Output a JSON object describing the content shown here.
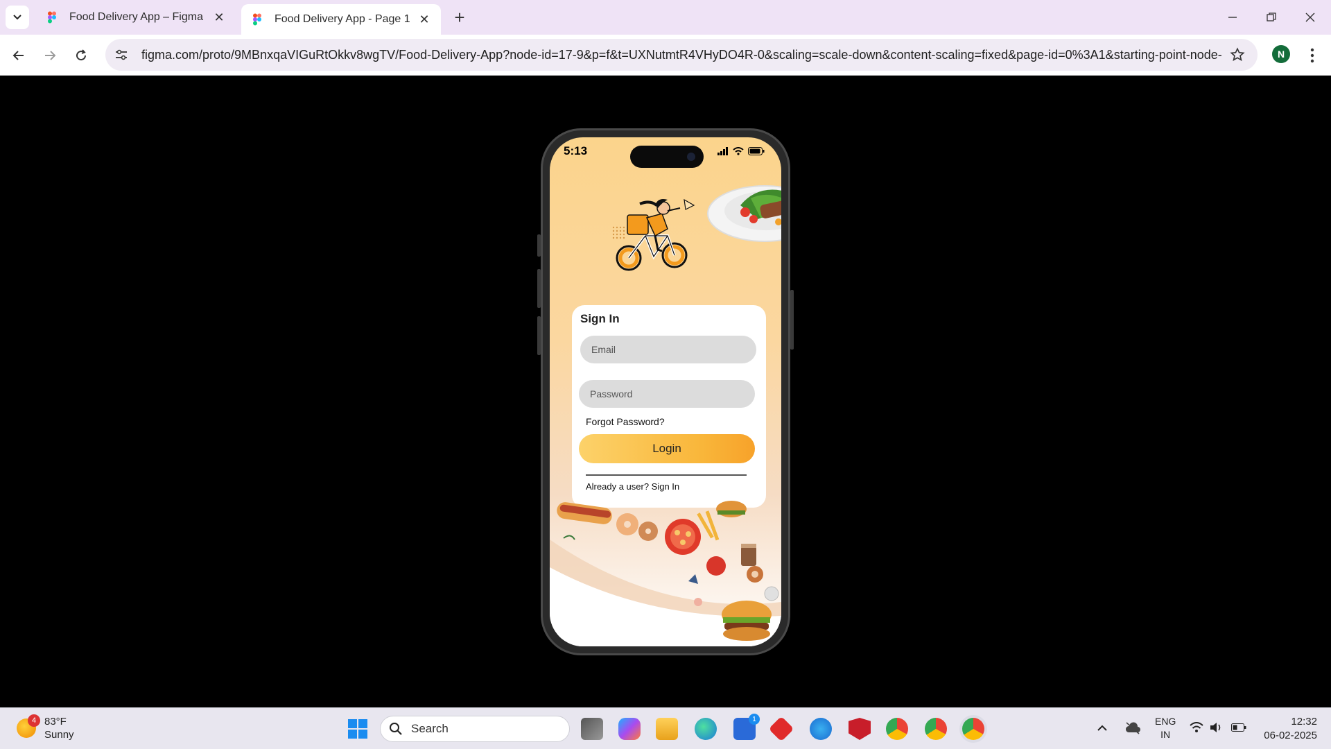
{
  "browser": {
    "tabs": [
      {
        "title": "Food Delivery App – Figma",
        "active": false
      },
      {
        "title": "Food Delivery App - Page 1",
        "active": true
      }
    ],
    "url": "figma.com/proto/9MBnxqaVIGuRtOkkv8wgTV/Food-Delivery-App?node-id=17-9&p=f&t=UXNutmtR4VHyDO4R-0&scaling=scale-down&content-scaling=fixed&page-id=0%3A1&starting-point-node-...",
    "profile_initial": "N"
  },
  "phone": {
    "status_time": "5:13",
    "signin": {
      "title": "Sign In",
      "email_placeholder": "Email",
      "password_placeholder": "Password",
      "forgot_label": "Forgot Password?",
      "login_label": "Login",
      "already_label": "Already a user? Sign In"
    }
  },
  "taskbar": {
    "weather_temp": "83°F",
    "weather_desc": "Sunny",
    "weather_badge": "4",
    "search_label": "Search",
    "store_badge": "1",
    "lang_line1": "ENG",
    "lang_line2": "IN",
    "time": "12:32",
    "date": "06-02-2025"
  },
  "colors": {
    "accent_orange": "#f9b63a",
    "tab_bar": "#efe3f6",
    "taskbar": "#e8e6ef"
  }
}
